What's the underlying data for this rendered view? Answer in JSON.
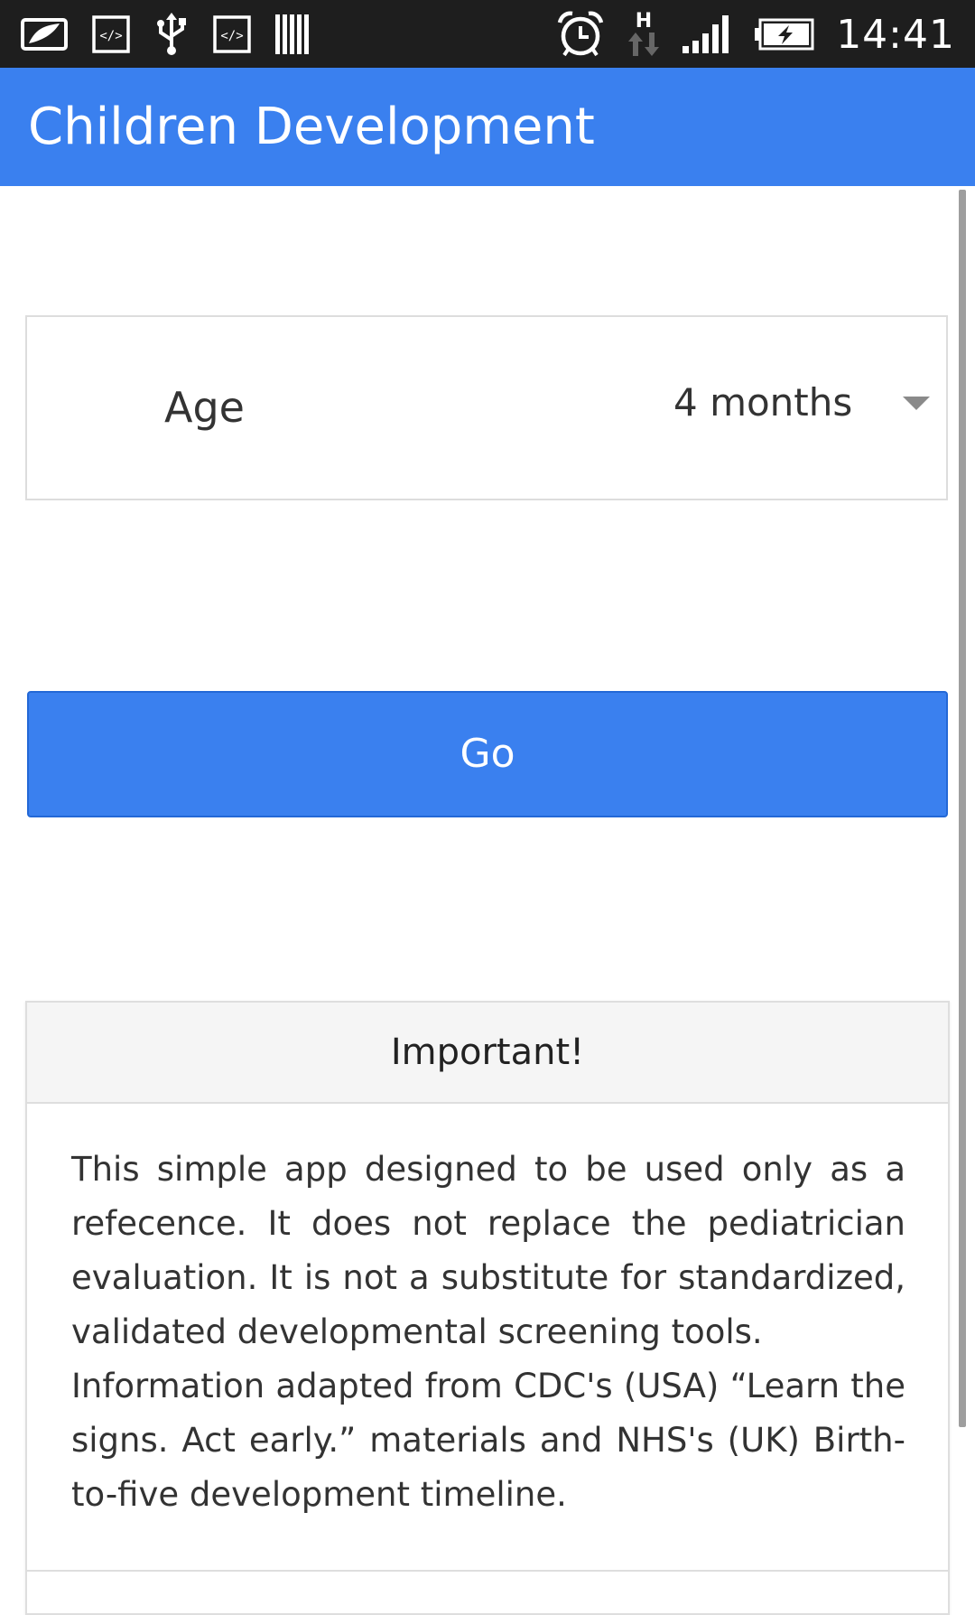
{
  "status_bar": {
    "time": "14:41",
    "left_icons": [
      "photo-frame-icon",
      "developer-code-icon",
      "usb-icon",
      "developer-code-icon",
      "barcode-icon"
    ],
    "right_icons": [
      "alarm-clock-icon",
      "network-h-data-icon",
      "signal-strength-icon",
      "battery-charging-icon"
    ],
    "network_label": "H"
  },
  "app_bar": {
    "title": "Children Development",
    "background": "#3a80ef"
  },
  "age_selector": {
    "label": "Age",
    "selected_value": "4 months",
    "arrow_icon": "dropdown-arrow-icon"
  },
  "go_button": {
    "label": "Go",
    "background": "#3a80ef"
  },
  "notice_card": {
    "header": "Important!",
    "paragraphs": [
      "This simple app designed to be used only as a refecence. It does not replace the pediatrician evaluation. It is not a substitute for standardized, validated developmental screening tools.",
      "Information adapted from CDC's (USA) “Learn the signs. Act early.” materials and NHS's (UK) Birth-to-five development timeline."
    ]
  }
}
